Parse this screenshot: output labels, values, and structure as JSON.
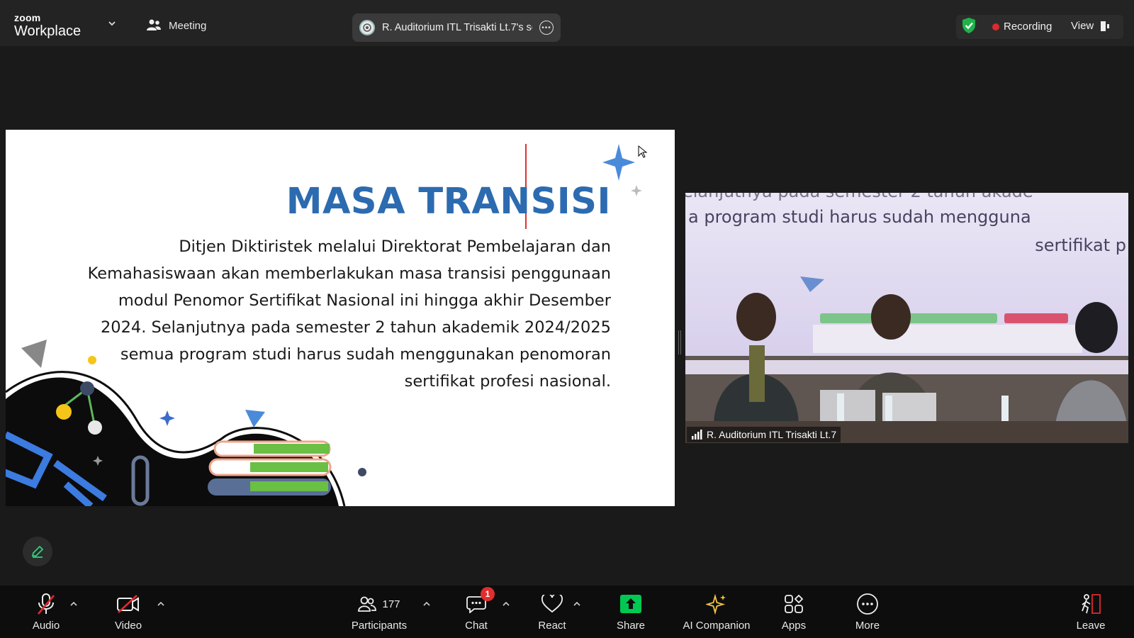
{
  "app": {
    "brand_top": "zoom",
    "brand_bottom": "Workplace"
  },
  "header": {
    "meeting_label": "Meeting",
    "share_title": "R. Auditorium ITL Trisakti Lt.7's sc",
    "recording_label": "Recording",
    "view_label": "View"
  },
  "slide": {
    "title": "MASA TRANSISI",
    "lines": [
      "Ditjen Diktiristek melalui Direktorat Pembelajaran dan",
      "Kemahasiswaan akan memberlakukan masa transisi penggunaan",
      "modul Penomor Sertifikat Nasional ini hingga akhir Desember",
      "2024. Selanjutnya pada semester 2 tahun akademik 2024/2025",
      "semua program studi harus sudah menggunakan penomoran",
      "sertifikat profesi nasional."
    ]
  },
  "video": {
    "participant_name": "R. Auditorium ITL Trisakti Lt.7",
    "screen_text_1": "a program studi harus sudah mengguna",
    "screen_text_2": "sertifikat p"
  },
  "toolbar": {
    "audio": "Audio",
    "video": "Video",
    "participants": "Participants",
    "participants_count": "177",
    "chat": "Chat",
    "chat_badge": "1",
    "react": "React",
    "share": "Share",
    "ai_companion": "AI Companion",
    "apps": "Apps",
    "more": "More",
    "leave": "Leave"
  },
  "colors": {
    "accent_green": "#00c853",
    "record_red": "#e0282e",
    "slide_title_blue": "#2c6bb0",
    "ai_gold": "#f5c542"
  }
}
